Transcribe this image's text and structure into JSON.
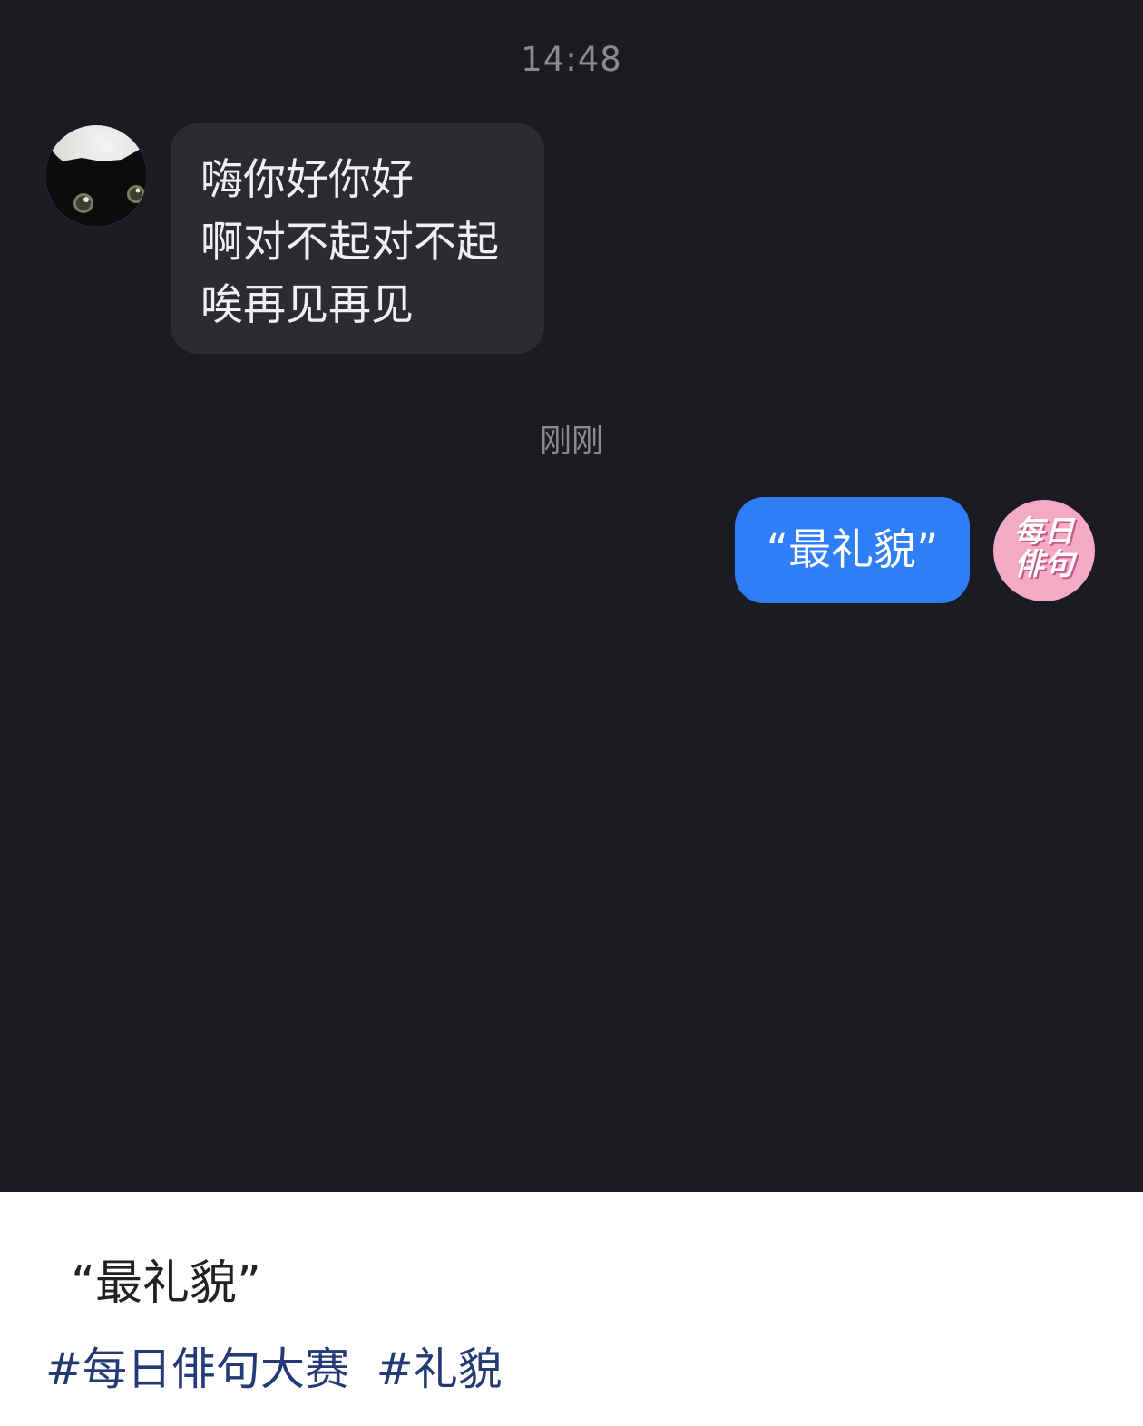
{
  "chat": {
    "time_header": "14:48",
    "time_recent": "刚刚",
    "incoming": {
      "sender_avatar": "black-cat-avatar",
      "lines": [
        "嗨你好你好",
        "啊对不起对不起",
        "唉再见再见"
      ]
    },
    "outgoing": {
      "text": "“最礼貌”",
      "sender_avatar": {
        "logo_line1": "每日",
        "logo_line2": "俳句",
        "color": "#f4a9c4"
      }
    },
    "colors": {
      "background": "#1b1b22",
      "incoming_bubble": "#2b2b32",
      "outgoing_bubble": "#2f7df7"
    }
  },
  "post": {
    "caption": "“最礼貌”",
    "hashtags": [
      "#每日俳句大赛",
      "#礼貌"
    ],
    "hashtag_color": "#233a74"
  }
}
